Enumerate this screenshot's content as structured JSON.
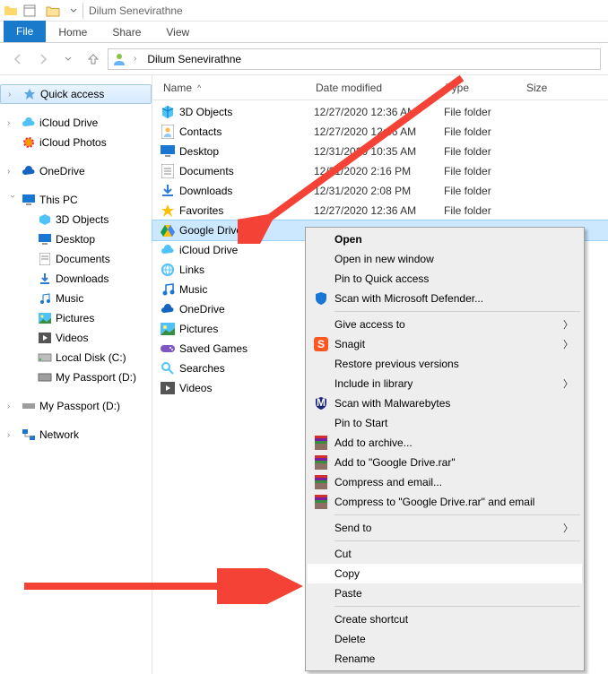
{
  "titlebar": {
    "title": "Dilum Senevirathne"
  },
  "ribbon": {
    "file": "File",
    "tabs": [
      "Home",
      "Share",
      "View"
    ]
  },
  "breadcrumb": {
    "root": "Dilum Senevirathne"
  },
  "columns": {
    "name": "Name",
    "date": "Date modified",
    "type": "Type",
    "size": "Size"
  },
  "sidebar": {
    "quick_access": "Quick access",
    "icloud_drive": "iCloud Drive",
    "icloud_photos": "iCloud Photos",
    "onedrive": "OneDrive",
    "this_pc": "This PC",
    "this_pc_children": [
      "3D Objects",
      "Desktop",
      "Documents",
      "Downloads",
      "Music",
      "Pictures",
      "Videos",
      "Local Disk (C:)",
      "My Passport (D:)"
    ],
    "my_passport": "My Passport (D:)",
    "network": "Network"
  },
  "files": [
    {
      "name": "3D Objects",
      "date": "12/27/2020 12:36 AM",
      "type": "File folder",
      "icon": "3d"
    },
    {
      "name": "Contacts",
      "date": "12/27/2020 12:36 AM",
      "type": "File folder",
      "icon": "contacts"
    },
    {
      "name": "Desktop",
      "date": "12/31/2020 10:35 AM",
      "type": "File folder",
      "icon": "desktop"
    },
    {
      "name": "Documents",
      "date": "12/31/2020 2:16 PM",
      "type": "File folder",
      "icon": "docs"
    },
    {
      "name": "Downloads",
      "date": "12/31/2020 2:08 PM",
      "type": "File folder",
      "icon": "downloads"
    },
    {
      "name": "Favorites",
      "date": "12/27/2020 12:36 AM",
      "type": "File folder",
      "icon": "star"
    },
    {
      "name": "Google Drive",
      "date": "",
      "type": "",
      "icon": "gdrive",
      "selected": true
    },
    {
      "name": "iCloud Drive",
      "date": "",
      "type": "",
      "icon": "icloud",
      "faded": true
    },
    {
      "name": "Links",
      "date": "",
      "type": "",
      "icon": "links",
      "faded": true
    },
    {
      "name": "Music",
      "date": "",
      "type": "",
      "icon": "music",
      "faded": true
    },
    {
      "name": "OneDrive",
      "date": "",
      "type": "",
      "icon": "onedrive",
      "faded": true
    },
    {
      "name": "Pictures",
      "date": "",
      "type": "",
      "icon": "pictures",
      "faded": true
    },
    {
      "name": "Saved Games",
      "date": "",
      "type": "",
      "icon": "games",
      "faded": true
    },
    {
      "name": "Searches",
      "date": "",
      "type": "",
      "icon": "search",
      "faded": true
    },
    {
      "name": "Videos",
      "date": "",
      "type": "",
      "icon": "videos",
      "faded": true
    }
  ],
  "context_menu": [
    {
      "label": "Open",
      "bold": true
    },
    {
      "label": "Open in new window"
    },
    {
      "label": "Pin to Quick access"
    },
    {
      "label": "Scan with Microsoft Defender...",
      "icon": "defender"
    },
    {
      "sep": true
    },
    {
      "label": "Give access to",
      "arrow": true
    },
    {
      "label": "Snagit",
      "icon": "snagit",
      "arrow": true
    },
    {
      "label": "Restore previous versions"
    },
    {
      "label": "Include in library",
      "arrow": true
    },
    {
      "label": "Scan with Malwarebytes",
      "icon": "mbam"
    },
    {
      "label": "Pin to Start"
    },
    {
      "label": "Add to archive...",
      "icon": "rar"
    },
    {
      "label": "Add to \"Google Drive.rar\"",
      "icon": "rar"
    },
    {
      "label": "Compress and email...",
      "icon": "rar"
    },
    {
      "label": "Compress to \"Google Drive.rar\" and email",
      "icon": "rar"
    },
    {
      "sep": true
    },
    {
      "label": "Send to",
      "arrow": true
    },
    {
      "sep": true
    },
    {
      "label": "Cut"
    },
    {
      "label": "Copy",
      "highlight": true
    },
    {
      "label": "Paste"
    },
    {
      "sep": true
    },
    {
      "label": "Create shortcut"
    },
    {
      "label": "Delete"
    },
    {
      "label": "Rename"
    }
  ]
}
